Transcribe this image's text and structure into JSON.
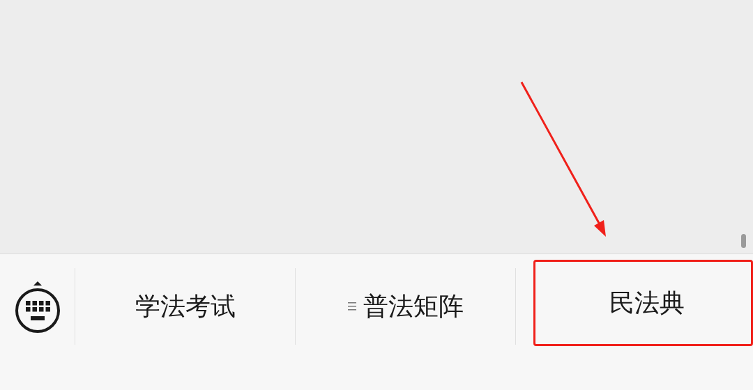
{
  "menu_bar": {
    "items": [
      {
        "label": "学法考试",
        "has_submenu": false,
        "highlighted": false
      },
      {
        "label": "普法矩阵",
        "has_submenu": true,
        "highlighted": false
      },
      {
        "label": "民法典",
        "has_submenu": false,
        "highlighted": true
      }
    ]
  }
}
